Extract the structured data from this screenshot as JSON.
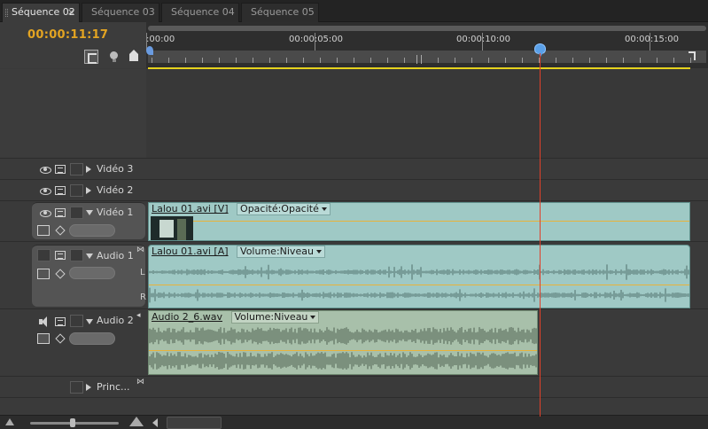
{
  "tabs": [
    {
      "label": "Séquence 02",
      "active": true
    },
    {
      "label": "Séquence 03",
      "active": false
    },
    {
      "label": "Séquence 04",
      "active": false
    },
    {
      "label": "Séquence 05",
      "active": false
    }
  ],
  "tab_close_glyph": "×",
  "timecode": "00:00:11:17",
  "ruler": {
    "labels": [
      ":00:00",
      "00:00:05:00",
      "00:00:10:00",
      "00:00:15:00"
    ]
  },
  "tracks": {
    "video3": {
      "name": "Vidéo 3"
    },
    "video2": {
      "name": "Vidéo 2"
    },
    "video1": {
      "name": "Vidéo 1"
    },
    "audio1": {
      "name": "Audio 1"
    },
    "audio2": {
      "name": "Audio 2"
    },
    "master": {
      "name": "Princ..."
    }
  },
  "clips": {
    "video1": {
      "name": "Lalou 01.avi [V]",
      "effect": "Opacité:Opacité"
    },
    "audio1": {
      "name": "Lalou 01.avi [A]",
      "effect": "Volume:Niveau"
    },
    "audio2": {
      "name": "Audio 2_6.wav",
      "effect": "Volume:Niveau"
    }
  },
  "channel_labels": {
    "left": "L",
    "right": "R"
  },
  "colors": {
    "timecode": "#e3a422",
    "playhead": "#e0402a",
    "work_area": "#e5d21e",
    "clip_video": "#9fc9c5",
    "clip_audio2": "#a8c0aa",
    "rubber_band": "#e8b23a"
  },
  "icons": {
    "snap": "snap-icon",
    "marker": "set-marker-icon",
    "eye": "eye-icon",
    "film": "film-icon",
    "speaker": "speaker-icon",
    "keyframe": "keyframe-icon"
  }
}
